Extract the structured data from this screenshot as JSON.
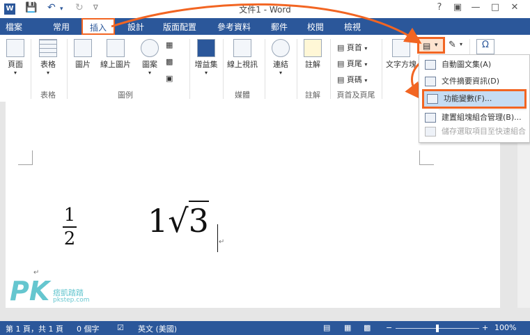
{
  "window": {
    "title": "文件1 - Word"
  },
  "tabs": [
    {
      "label": "檔案"
    },
    {
      "label": "常用"
    },
    {
      "label": "插入"
    },
    {
      "label": "設計"
    },
    {
      "label": "版面配置"
    },
    {
      "label": "參考資料"
    },
    {
      "label": "郵件"
    },
    {
      "label": "校閱"
    },
    {
      "label": "檢視"
    }
  ],
  "ribbon": {
    "buttons": {
      "page": "頁面",
      "table": "表格",
      "picture": "圖片",
      "online_picture": "線上圖片",
      "shapes": "圖案",
      "addins": "增益集",
      "online_video": "線上視訊",
      "link": "連結",
      "comment": "註解",
      "header": "頁首",
      "footer": "頁尾",
      "page_number": "頁碼",
      "textbox": "文字方塊"
    },
    "groups": {
      "table": "表格",
      "illustrations": "圖例",
      "media": "媒體",
      "comments": "註解",
      "header_footer": "頁首及頁尾"
    }
  },
  "dropdown": {
    "items": [
      {
        "label": "自動圖文集(A)"
      },
      {
        "label": "文件摘要資訊(D)"
      },
      {
        "label": "功能變數(F)..."
      },
      {
        "label": "建置組塊組合管理(B)..."
      },
      {
        "label": "儲存選取項目至快速組合"
      }
    ]
  },
  "callout": {
    "text": "功能變數"
  },
  "document": {
    "fraction": {
      "numerator": "1",
      "denominator": "2"
    },
    "sqrt": {
      "coefficient": "1",
      "radicand": "3"
    },
    "para_mark": "↵"
  },
  "watermark": {
    "logo": "PK",
    "site": "痞凱踏踏",
    "url": "pkstep.com"
  },
  "status": {
    "page": "第 1 頁，共 1 頁",
    "words": "0 個字",
    "language": "英文 (美國)",
    "zoom": "100%"
  },
  "colors": {
    "accent": "#2b579a",
    "highlight": "#f26522"
  }
}
